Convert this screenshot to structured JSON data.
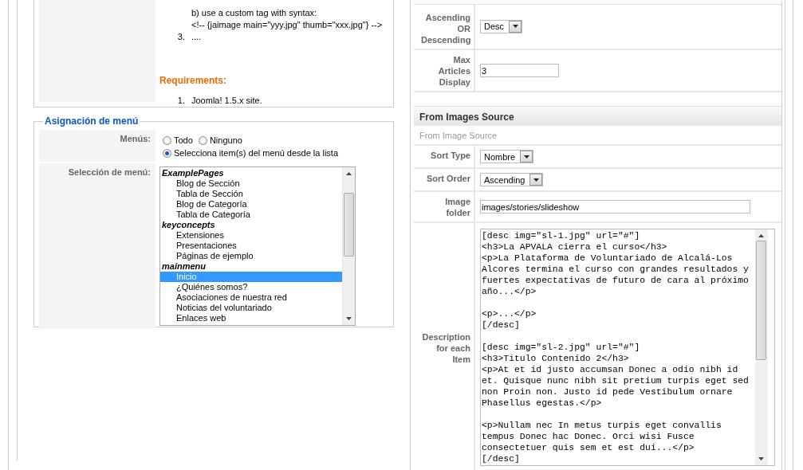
{
  "instructions": {
    "sub_items": [
      "b) use a custom tag with syntax:",
      "<!-- {jaimage main=\"yyy.jpg\" thumb=\"xxx.jpg\"} -->"
    ],
    "next_item": {
      "number": "3.",
      "text": "...."
    },
    "requirements_title": "Requirements:",
    "requirements": [
      {
        "number": "1.",
        "text": "Joomla! 1.5.x site."
      }
    ]
  },
  "menu_assignment": {
    "legend": "Asignación de menú",
    "menus_label": "Menús:",
    "options": [
      {
        "label": "Todo",
        "selected": false
      },
      {
        "label": "Ninguno",
        "selected": false
      },
      {
        "label": "Selecciona item(s) del menú desde la lista",
        "selected": true
      }
    ],
    "selection_label": "Selección de menú:",
    "menu_list": [
      {
        "label": "ExamplePages",
        "kind": "group",
        "selected": false
      },
      {
        "label": "Blog de Sección",
        "kind": "item",
        "selected": false
      },
      {
        "label": "Tabla de Sección",
        "kind": "item",
        "selected": false
      },
      {
        "label": "Blog de Categoría",
        "kind": "item",
        "selected": false
      },
      {
        "label": "Tabla de Categoría",
        "kind": "item",
        "selected": false
      },
      {
        "label": "keyconcepts",
        "kind": "group",
        "selected": false
      },
      {
        "label": "Extensiones",
        "kind": "item",
        "selected": false
      },
      {
        "label": "Presentaciones",
        "kind": "item",
        "selected": false
      },
      {
        "label": "Páginas de ejemplo",
        "kind": "item",
        "selected": false
      },
      {
        "label": "mainmenu",
        "kind": "group",
        "selected": false
      },
      {
        "label": "Inicio",
        "kind": "item",
        "selected": true
      },
      {
        "label": "¿Quiénes somos?",
        "kind": "item",
        "selected": false
      },
      {
        "label": "Asociaciones de nuestra red",
        "kind": "item",
        "selected": false
      },
      {
        "label": "Noticias del voluntariado",
        "kind": "item",
        "selected": false
      },
      {
        "label": "Enlaces web",
        "kind": "item",
        "selected": false
      }
    ]
  },
  "parameters": [
    {
      "kind": "select",
      "label": "Ascending OR Descending",
      "value": "Desc"
    },
    {
      "kind": "text",
      "label": "Max Articles Display",
      "value": "3"
    },
    {
      "kind": "header",
      "label": "From Images Source"
    },
    {
      "kind": "note",
      "label": "From Image Source"
    },
    {
      "kind": "select",
      "label": "Sort Type",
      "value": "Nombre"
    },
    {
      "kind": "select",
      "label": "Sort Order",
      "value": "Ascending"
    },
    {
      "kind": "path",
      "label": "Image folder",
      "value": "images/stories/slideshow"
    },
    {
      "kind": "textarea",
      "label": "Description for each Item",
      "value": "[desc img=\"sl-1.jpg\" url=\"#\"]\n<h3>La APVALA cierra el curso</h3>\n<p>La Plataforma de Voluntariado de Alcalá-Los Alcores termina el curso con grandes resultados y fuertes expectativas de futuro de cara al próximo año...</p>\n\n<p>...</p>\n[/desc]\n\n[desc img=\"sl-2.jpg\" url=\"#\"]\n<h3>Titulo Contenido 2</h3>\n<p>At et id justo accumsan Donec a odio nibh id et. Quisque nunc nibh sit pretium turpis eget sed non Proin non. Justo id pede Vestibulum ornare Phasellus egestas.</p>\n\n<p>Nullam nec In metus turpis eget convallis tempus Donec hac Donec. Orci wisi Fusce consectetuer quis sem et est dui...</p>\n[/desc]"
    }
  ]
}
